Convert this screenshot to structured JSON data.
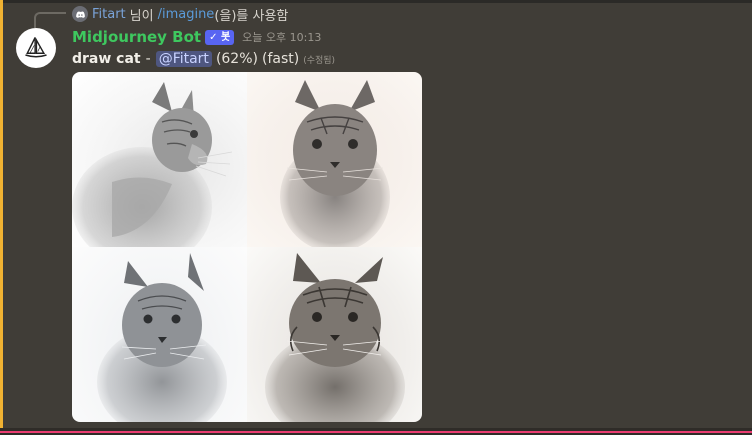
{
  "reply": {
    "user": "Fitart",
    "text": "님이",
    "command": "/imagine",
    "suffix": "(을)를 사용함"
  },
  "message": {
    "author": "Midjourney Bot",
    "badge": "✓ 봇",
    "timestamp": "오늘 오후 10:13",
    "prompt": "draw cat",
    "separator": "-",
    "mention": "@Fitart",
    "progress": "(62%)",
    "mode": "(fast)",
    "edited": "(수정됨)"
  },
  "image": {
    "tiles": [
      "cat-sketch-1",
      "cat-sketch-2",
      "cat-sketch-3",
      "cat-sketch-4"
    ],
    "progress_fraction": 0.62
  },
  "colors": {
    "background": "#403d37",
    "author": "#3ec85f",
    "badge": "#5865f2",
    "mention_bg": "#4e5680",
    "accent_left": "#f0b232",
    "accent_bottom": "#ff3f7a"
  }
}
